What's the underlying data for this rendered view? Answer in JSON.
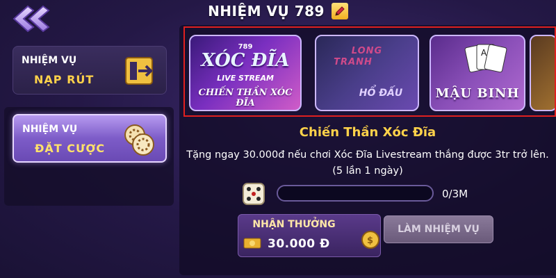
{
  "header": {
    "title": "NHIỆM VỤ 789",
    "back_icon": "double-chevron-left-icon",
    "edit_icon": "edit-pencil-icon"
  },
  "sidebar": {
    "items": [
      {
        "line1": "NHIỆM VỤ",
        "line2": "NẠP RÚT",
        "icon": "withdraw-exit-icon",
        "selected": false
      },
      {
        "line1": "NHIỆM VỤ",
        "line2": "ĐẶT CƯỢC",
        "icon": "casino-chips-icon",
        "selected": true
      }
    ]
  },
  "games": [
    {
      "brand": "789",
      "title": "XÓC ĐĨA",
      "tag": "LIVE STREAM",
      "subtitle": "CHIẾN THẦN XÓC ĐĨA",
      "selected": true
    },
    {
      "title_line1": "LONG",
      "title_line2": "TRANH",
      "title_line3": "HỔ ĐẤU"
    },
    {
      "title": "MẬU BINH"
    },
    {
      "title": ""
    }
  ],
  "task": {
    "title": "Chiến Thần Xóc Đĩa",
    "description": "Tặng ngay 30.000đ nếu chơi Xóc Đĩa Livestream thắng được 3tr trở lên. (5 lần 1 ngày)",
    "progress_text": "0/3M",
    "progress_fraction": 0,
    "reward_label": "NHẬN THƯỞNG",
    "reward_value": "30.000 Đ",
    "action_label": "LÀM NHIỆM VỤ"
  },
  "colors": {
    "accent_gold": "#ffd24a",
    "highlight_frame": "#e02020",
    "panel_bg": "#241846"
  }
}
